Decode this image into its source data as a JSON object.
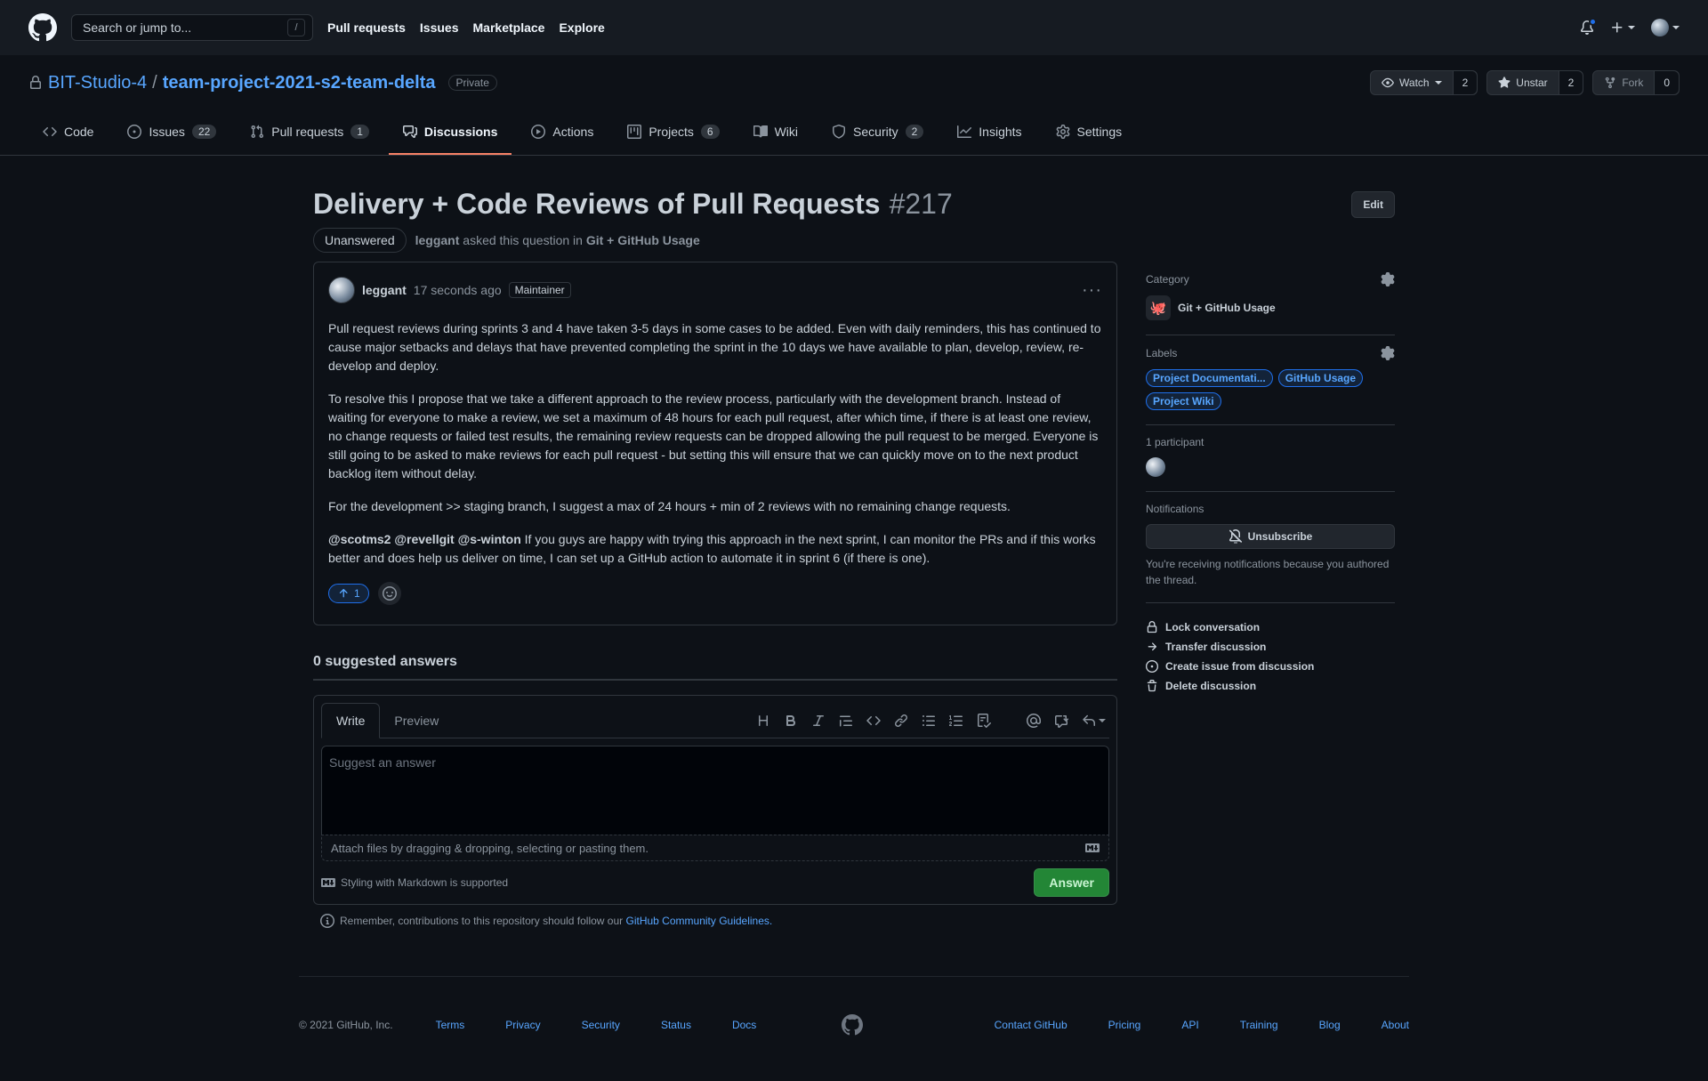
{
  "header": {
    "search_placeholder": "Search or jump to...",
    "search_key": "/",
    "nav": [
      "Pull requests",
      "Issues",
      "Marketplace",
      "Explore"
    ]
  },
  "repo": {
    "owner": "BIT-Studio-4",
    "name": "team-project-2021-s2-team-delta",
    "visibility": "Private",
    "watch_label": "Watch",
    "watch_count": "2",
    "star_label": "Unstar",
    "star_count": "2",
    "fork_label": "Fork",
    "fork_count": "0",
    "tabs": [
      {
        "label": "Code",
        "count": ""
      },
      {
        "label": "Issues",
        "count": "22"
      },
      {
        "label": "Pull requests",
        "count": "1"
      },
      {
        "label": "Discussions",
        "count": ""
      },
      {
        "label": "Actions",
        "count": ""
      },
      {
        "label": "Projects",
        "count": "6"
      },
      {
        "label": "Wiki",
        "count": ""
      },
      {
        "label": "Security",
        "count": "2"
      },
      {
        "label": "Insights",
        "count": ""
      },
      {
        "label": "Settings",
        "count": ""
      }
    ]
  },
  "discussion": {
    "title": "Delivery + Code Reviews of Pull Requests",
    "number": "#217",
    "edit_label": "Edit",
    "status": "Unanswered",
    "author": "leggant",
    "asked_text": "asked this question in",
    "category": "Git + GitHub Usage",
    "post": {
      "author": "leggant",
      "time": "17 seconds ago",
      "role": "Maintainer",
      "paragraphs": [
        "Pull request reviews during sprints 3 and 4 have taken 3-5 days in some cases to be added. Even with daily reminders, this has continued to cause major setbacks and delays that have prevented completing the sprint in the 10 days we have available to plan, develop, review, re-develop and deploy.",
        "To resolve this I propose that we take a different approach to the review process, particularly with the development branch. Instead of waiting for everyone to make a review, we set a maximum of 48 hours for each pull request, after which time, if there is at least one review, no change requests or failed test results, the remaining review requests can be dropped allowing the pull request to be merged. Everyone is still going to be asked to make reviews for each pull request - but setting this will ensure that we can quickly move on to the next product backlog item without delay.",
        "For the development >> staging branch, I suggest a max of 24 hours + min of 2 reviews with no remaining change requests."
      ],
      "mentions": "@scotms2 @revellgit @s-winton",
      "last_paragraph": "If you guys are happy with trying this approach in the next sprint, I can monitor the PRs and if this works better and does help us deliver on time, I can set up a GitHub action to automate it in sprint 6 (if there is one).",
      "upvotes": "1"
    },
    "suggested_answers": "0 suggested answers",
    "editor": {
      "write_tab": "Write",
      "preview_tab": "Preview",
      "placeholder": "Suggest an answer",
      "attach_text": "Attach files by dragging & dropping, selecting or pasting them.",
      "markdown_note": "Styling with Markdown is supported",
      "answer_label": "Answer"
    },
    "guidelines_prefix": "Remember, contributions to this repository should follow our",
    "guidelines_link": "GitHub Community Guidelines",
    "guidelines_suffix": "."
  },
  "sidebar": {
    "category_heading": "Category",
    "category_name": "Git + GitHub Usage",
    "labels_heading": "Labels",
    "labels": [
      "Project Documentati...",
      "GitHub Usage",
      "Project Wiki"
    ],
    "participants_heading": "1 participant",
    "notifications_heading": "Notifications",
    "unsubscribe_label": "Unsubscribe",
    "notifications_note": "You're receiving notifications because you authored the thread.",
    "actions": [
      "Lock conversation",
      "Transfer discussion",
      "Create issue from discussion",
      "Delete discussion"
    ]
  },
  "footer": {
    "copyright": "© 2021 GitHub, Inc.",
    "left_links": [
      "Terms",
      "Privacy",
      "Security",
      "Status",
      "Docs"
    ],
    "right_links": [
      "Contact GitHub",
      "Pricing",
      "API",
      "Training",
      "Blog",
      "About"
    ]
  }
}
